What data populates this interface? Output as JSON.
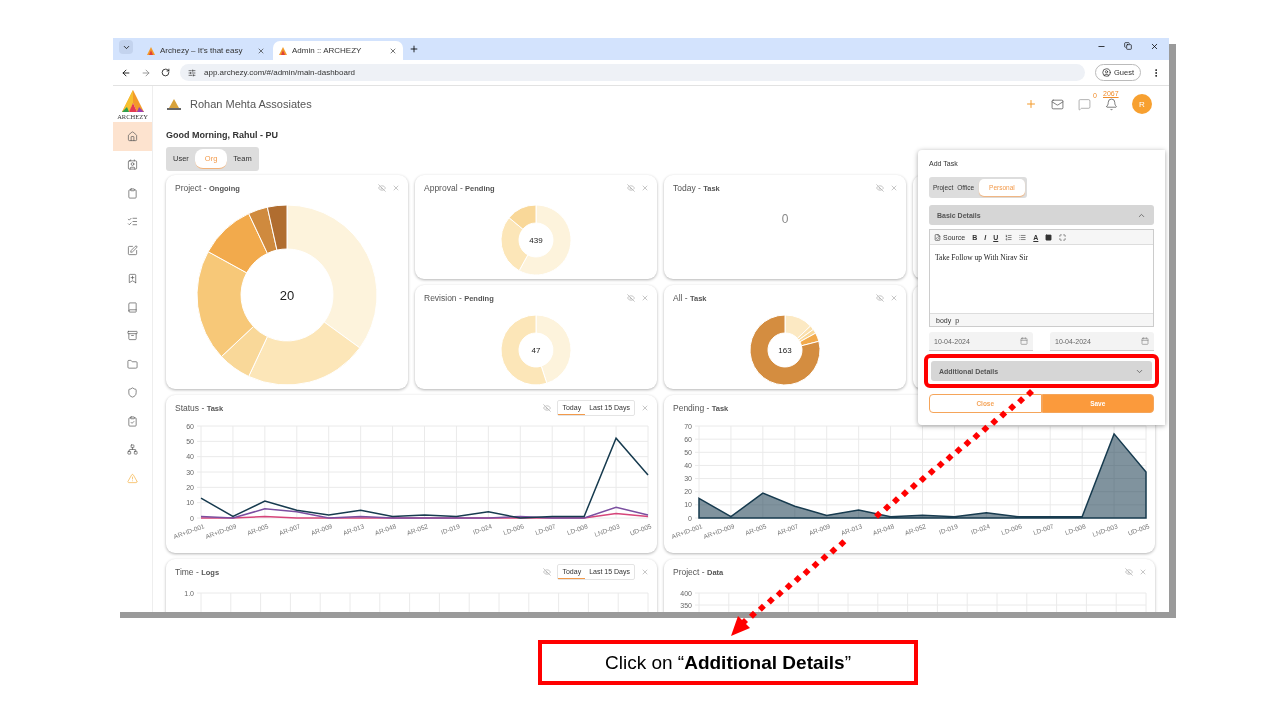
{
  "browser": {
    "tabs": [
      {
        "title": "Archezy – It's that easy",
        "selected": false
      },
      {
        "title": "Admin :: ARCHEZY",
        "selected": true
      }
    ],
    "url": "app.archezy.com/#/admin/main-dashboard",
    "profile": "Guest"
  },
  "sidebar": {
    "logo_text": "ARCHEZY",
    "items": [
      {
        "selected": true
      },
      {
        "selected": false
      },
      {
        "selected": false
      },
      {
        "selected": false
      },
      {
        "selected": false
      },
      {
        "selected": false
      },
      {
        "selected": false
      },
      {
        "selected": false
      },
      {
        "selected": false
      },
      {
        "selected": false
      },
      {
        "selected": false
      },
      {
        "selected": false
      },
      {
        "selected": false
      }
    ]
  },
  "header": {
    "company": "Rohan Mehta Assosiates",
    "messages": "0",
    "alerts": "2067",
    "avatar": "R"
  },
  "greeting": "Good Morning, Rahul - PU",
  "scope_tabs": [
    {
      "label": "User",
      "selected": false
    },
    {
      "label": "Org",
      "selected": true
    },
    {
      "label": "Team",
      "selected": false
    }
  ],
  "cards": [
    {
      "kind": "donut",
      "title": "Project - **Ongoing**",
      "total": "20"
    },
    {
      "kind": "donut",
      "title": "Approval - **Pending**",
      "total": "439"
    },
    {
      "kind": "donut",
      "title": "Revision - **Pending**",
      "total": "47"
    },
    {
      "kind": "count",
      "title": "Today - **Task**",
      "total": "0"
    },
    {
      "kind": "donut",
      "title": "All - **Task**",
      "total": "163"
    }
  ],
  "charts": [
    {
      "kind": "chart",
      "title": "Status - **Task**",
      "header_icons": true,
      "range_tabs": [
        {
          "label": "Today",
          "selected": true
        },
        {
          "label": "Last 15 Days",
          "selected": false
        }
      ],
      "chart_data": {
        "type": "line",
        "grid": true,
        "categories": [
          "AR+ID-001",
          "AR+ID-009",
          "AR-005",
          "AR-007",
          "AR-009",
          "AR-013",
          "AR-048",
          "AR-052",
          "ID-019",
          "ID-024",
          "LD-006",
          "LD-007",
          "LD-008",
          "LND-003",
          "UD-005"
        ],
        "ylim": [
          0,
          60
        ],
        "yticks": [
          0,
          10,
          20,
          30,
          40,
          50,
          60
        ],
        "series": [
          {
            "color": "#d6457a",
            "values": [
              0,
              0,
              1,
              0,
              0,
              0,
              0,
              0,
              0,
              0,
              0,
              0,
              0,
              3,
              1
            ]
          },
          {
            "color": "#7b4fa0",
            "values": [
              1,
              0,
              6,
              4,
              0,
              1,
              0,
              0,
              0,
              0,
              1,
              0,
              0,
              7,
              2
            ]
          },
          {
            "color": "#173b4f",
            "values": [
              13,
              1,
              11,
              5,
              2,
              5,
              1,
              2,
              1,
              4,
              0,
              1,
              1,
              52,
              28
            ]
          }
        ]
      }
    },
    {
      "kind": "chart",
      "title": "Pending - **Task**",
      "header_icons": false,
      "chart_data": {
        "type": "area",
        "grid": true,
        "categories": [
          "AR+ID-001",
          "AR+ID-009",
          "AR-005",
          "AR-007",
          "AR-009",
          "AR-013",
          "AR-048",
          "AR-052",
          "ID-019",
          "ID-024",
          "LD-006",
          "LD-007",
          "LD-008",
          "LND-003",
          "UD-005"
        ],
        "ylim": [
          0,
          70
        ],
        "yticks": [
          0,
          10,
          20,
          30,
          40,
          50,
          60,
          70
        ],
        "series": [
          {
            "color": "#173b4f",
            "values": [
              15,
              1,
              19,
              9,
              2,
              6,
              1,
              2,
              1,
              4,
              1,
              1,
              1,
              64,
              35
            ]
          }
        ]
      }
    },
    {
      "kind": "stub",
      "title": "Time - **Logs**",
      "header_icons": true,
      "range_tabs": [
        {
          "label": "Today",
          "selected": true
        },
        {
          "label": "Last 15 Days",
          "selected": false
        }
      ],
      "tick_labels": [
        "1.0"
      ]
    },
    {
      "kind": "stub",
      "title": "Project - **Data**",
      "header_icons": true,
      "tick_labels": [
        "400",
        "350"
      ]
    }
  ],
  "add_task": {
    "title": "Add Task",
    "types": [
      {
        "label": "Project",
        "selected": false
      },
      {
        "label": "Office",
        "selected": false
      },
      {
        "label": "Personal",
        "selected": true
      }
    ],
    "basic_details": {
      "label": "Basic Details",
      "expanded": true
    },
    "editor": {
      "source": "Source",
      "bold": "B",
      "italic": "I",
      "underline": "U",
      "text_color": "A",
      "content": "Take Follow up With Nirav Sir",
      "path": [
        "body",
        "p"
      ]
    },
    "start_date": "10-04-2024",
    "end_date": "10-04-2024",
    "additional_details": {
      "label": "Additional Details",
      "expanded": false,
      "highlighted": true
    },
    "buttons": [
      {
        "kind": "secondary",
        "label": "Close"
      },
      {
        "kind": "primary",
        "label": "Save"
      }
    ]
  },
  "callout": "Click on “**Additional Details**”"
}
